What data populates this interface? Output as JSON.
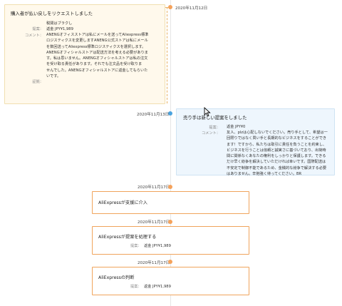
{
  "timeline": {
    "dates": {
      "d1": "2020年11月12日",
      "d2": "2020年11月13日",
      "d3": "2020年11月17日",
      "d4": "2020年11月17日",
      "d5": "2020年11月17日"
    }
  },
  "buyer_request": {
    "title": "購入者が払い戻しをリクエストしました",
    "reason": "税関はブラクし",
    "proposal_label": "提案：",
    "proposal_value": "返金 JPY¥1,989",
    "comment_label": "コメント：",
    "comment_lines": {
      "l1": "ANENGオフィスストアは私にメールを送ってAliexpress標準",
      "l2": "ロジスティクスを変更しますANENG公式ストアは私にメール",
      "l3": "を数回送ってAliexpress標準ロジスティクスを選択します。",
      "l4": "ANENGオフィシャルストアは配送方法を考える必要がありま",
      "l5": "す。私は思いません。ANENGオフィシャルストアは私の注文",
      "l6": "を受け取る責任があります。それでも注文品を受け取りま",
      "l7": "せんでした。ANENGオフィシャルストアに返金してもらいた",
      "l8": "いです。"
    },
    "evidence_label": "証拠："
  },
  "seller_proposal": {
    "title": "売り手は新しい提案をしました",
    "proposal_label": "提案：",
    "proposal_value": "返金 JPY¥0",
    "comment_label": "コメント：",
    "comment_lines": {
      "l1": "友人、plzは心配しないでください。売り手として、希望は一",
      "l2": "回限りではなく買い手と長期的なビジネスをすることができ",
      "l3": "ます！ですから、私たちは取引に責任を負うことを約束し、",
      "l4": "ビジネスを行うことは信頼と誠実さに基づいており、出荷時",
      "l5": "間に関係なくあなたの権利をしっかりと保護します。できる",
      "l6": "だけ早く紛争を解決していただければ幸いです。国際配送は",
      "l7": "不安定で制御不能であるため、金銭的な紛争で解決する必要",
      "l8": "はありません。辛抱強く待ってください。BR"
    }
  },
  "events": {
    "e1": {
      "title": "AliExpressが支援に介入"
    },
    "e2": {
      "title": "AliExpressが提案を処理する",
      "label": "提案：",
      "value": "返金 JPY¥1,989"
    },
    "e3": {
      "title": "AliExpressの判断",
      "label": "提案：",
      "value": "返金 JPY¥1,989"
    }
  },
  "colors": {
    "timeline_orange": "#f5a25b",
    "timeline_blue": "#4aa3df",
    "buyer_card_bg": "#fff9ec",
    "seller_card_bg": "#eef6fd",
    "event_border": "#f0a45c"
  },
  "icons": {
    "cursor": "mouse-pointer-icon"
  }
}
